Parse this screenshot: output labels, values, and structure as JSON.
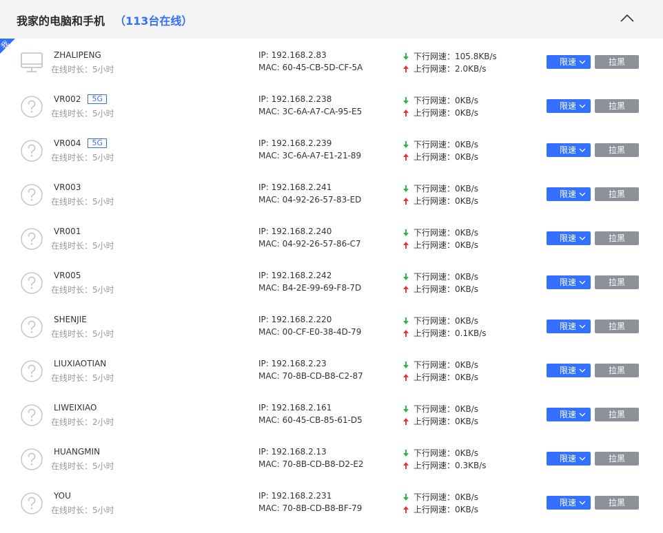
{
  "header": {
    "title": "我家的电脑和手机",
    "count_label": "（113台在线）"
  },
  "me_tag": "我",
  "labels": {
    "ip_prefix": "IP: ",
    "mac_prefix": "MAC: ",
    "down_prefix": "下行网速：",
    "up_prefix": "上行网速：",
    "online_prefix": "在线时长：",
    "limit_button": "限速",
    "block_button": "拉黑",
    "badge_5g": "5G"
  },
  "colors": {
    "accent": "#3370ff",
    "down_arrow": "#2fb344",
    "up_arrow": "#e53935",
    "block_button": "#8e9199"
  },
  "devices": [
    {
      "name": "ZHALIPENG",
      "icon": "monitor-icon",
      "band": "",
      "online": "5小时",
      "ip": "192.168.2.83",
      "mac": "60-45-CB-5D-CF-5A",
      "down": "105.8KB/s",
      "up": "2.0KB/s"
    },
    {
      "name": "VR002",
      "icon": "unknown-device-icon",
      "band": "5G",
      "online": "5小时",
      "ip": "192.168.2.238",
      "mac": "3C-6A-A7-CA-95-E5",
      "down": "0KB/s",
      "up": "0KB/s"
    },
    {
      "name": "VR004",
      "icon": "unknown-device-icon",
      "band": "5G",
      "online": "5小时",
      "ip": "192.168.2.239",
      "mac": "3C-6A-A7-E1-21-89",
      "down": "0KB/s",
      "up": "0KB/s"
    },
    {
      "name": "VR003",
      "icon": "unknown-device-icon",
      "band": "",
      "online": "5小时",
      "ip": "192.168.2.241",
      "mac": "04-92-26-57-83-ED",
      "down": "0KB/s",
      "up": "0KB/s"
    },
    {
      "name": "VR001",
      "icon": "unknown-device-icon",
      "band": "",
      "online": "5小时",
      "ip": "192.168.2.240",
      "mac": "04-92-26-57-86-C7",
      "down": "0KB/s",
      "up": "0KB/s"
    },
    {
      "name": "VR005",
      "icon": "unknown-device-icon",
      "band": "",
      "online": "5小时",
      "ip": "192.168.2.242",
      "mac": "B4-2E-99-69-F8-7D",
      "down": "0KB/s",
      "up": "0KB/s"
    },
    {
      "name": "SHENJIE",
      "icon": "unknown-device-icon",
      "band": "",
      "online": "5小时",
      "ip": "192.168.2.220",
      "mac": "00-CF-E0-38-4D-79",
      "down": "0KB/s",
      "up": "0.1KB/s"
    },
    {
      "name": "LIUXIAOTIAN",
      "icon": "unknown-device-icon",
      "band": "",
      "online": "5小时",
      "ip": "192.168.2.23",
      "mac": "70-8B-CD-B8-C2-87",
      "down": "0KB/s",
      "up": "0KB/s"
    },
    {
      "name": "LIWEIXIAO",
      "icon": "unknown-device-icon",
      "band": "",
      "online": "2小时",
      "ip": "192.168.2.161",
      "mac": "60-45-CB-85-61-D5",
      "down": "0KB/s",
      "up": "0KB/s"
    },
    {
      "name": "HUANGMIN",
      "icon": "unknown-device-icon",
      "band": "",
      "online": "5小时",
      "ip": "192.168.2.13",
      "mac": "70-8B-CD-B8-D2-E2",
      "down": "0KB/s",
      "up": "0.3KB/s"
    },
    {
      "name": "YOU",
      "icon": "unknown-device-icon",
      "band": "",
      "online": "5小时",
      "ip": "192.168.2.231",
      "mac": "70-8B-CD-B8-BF-79",
      "down": "0KB/s",
      "up": "0KB/s"
    }
  ]
}
